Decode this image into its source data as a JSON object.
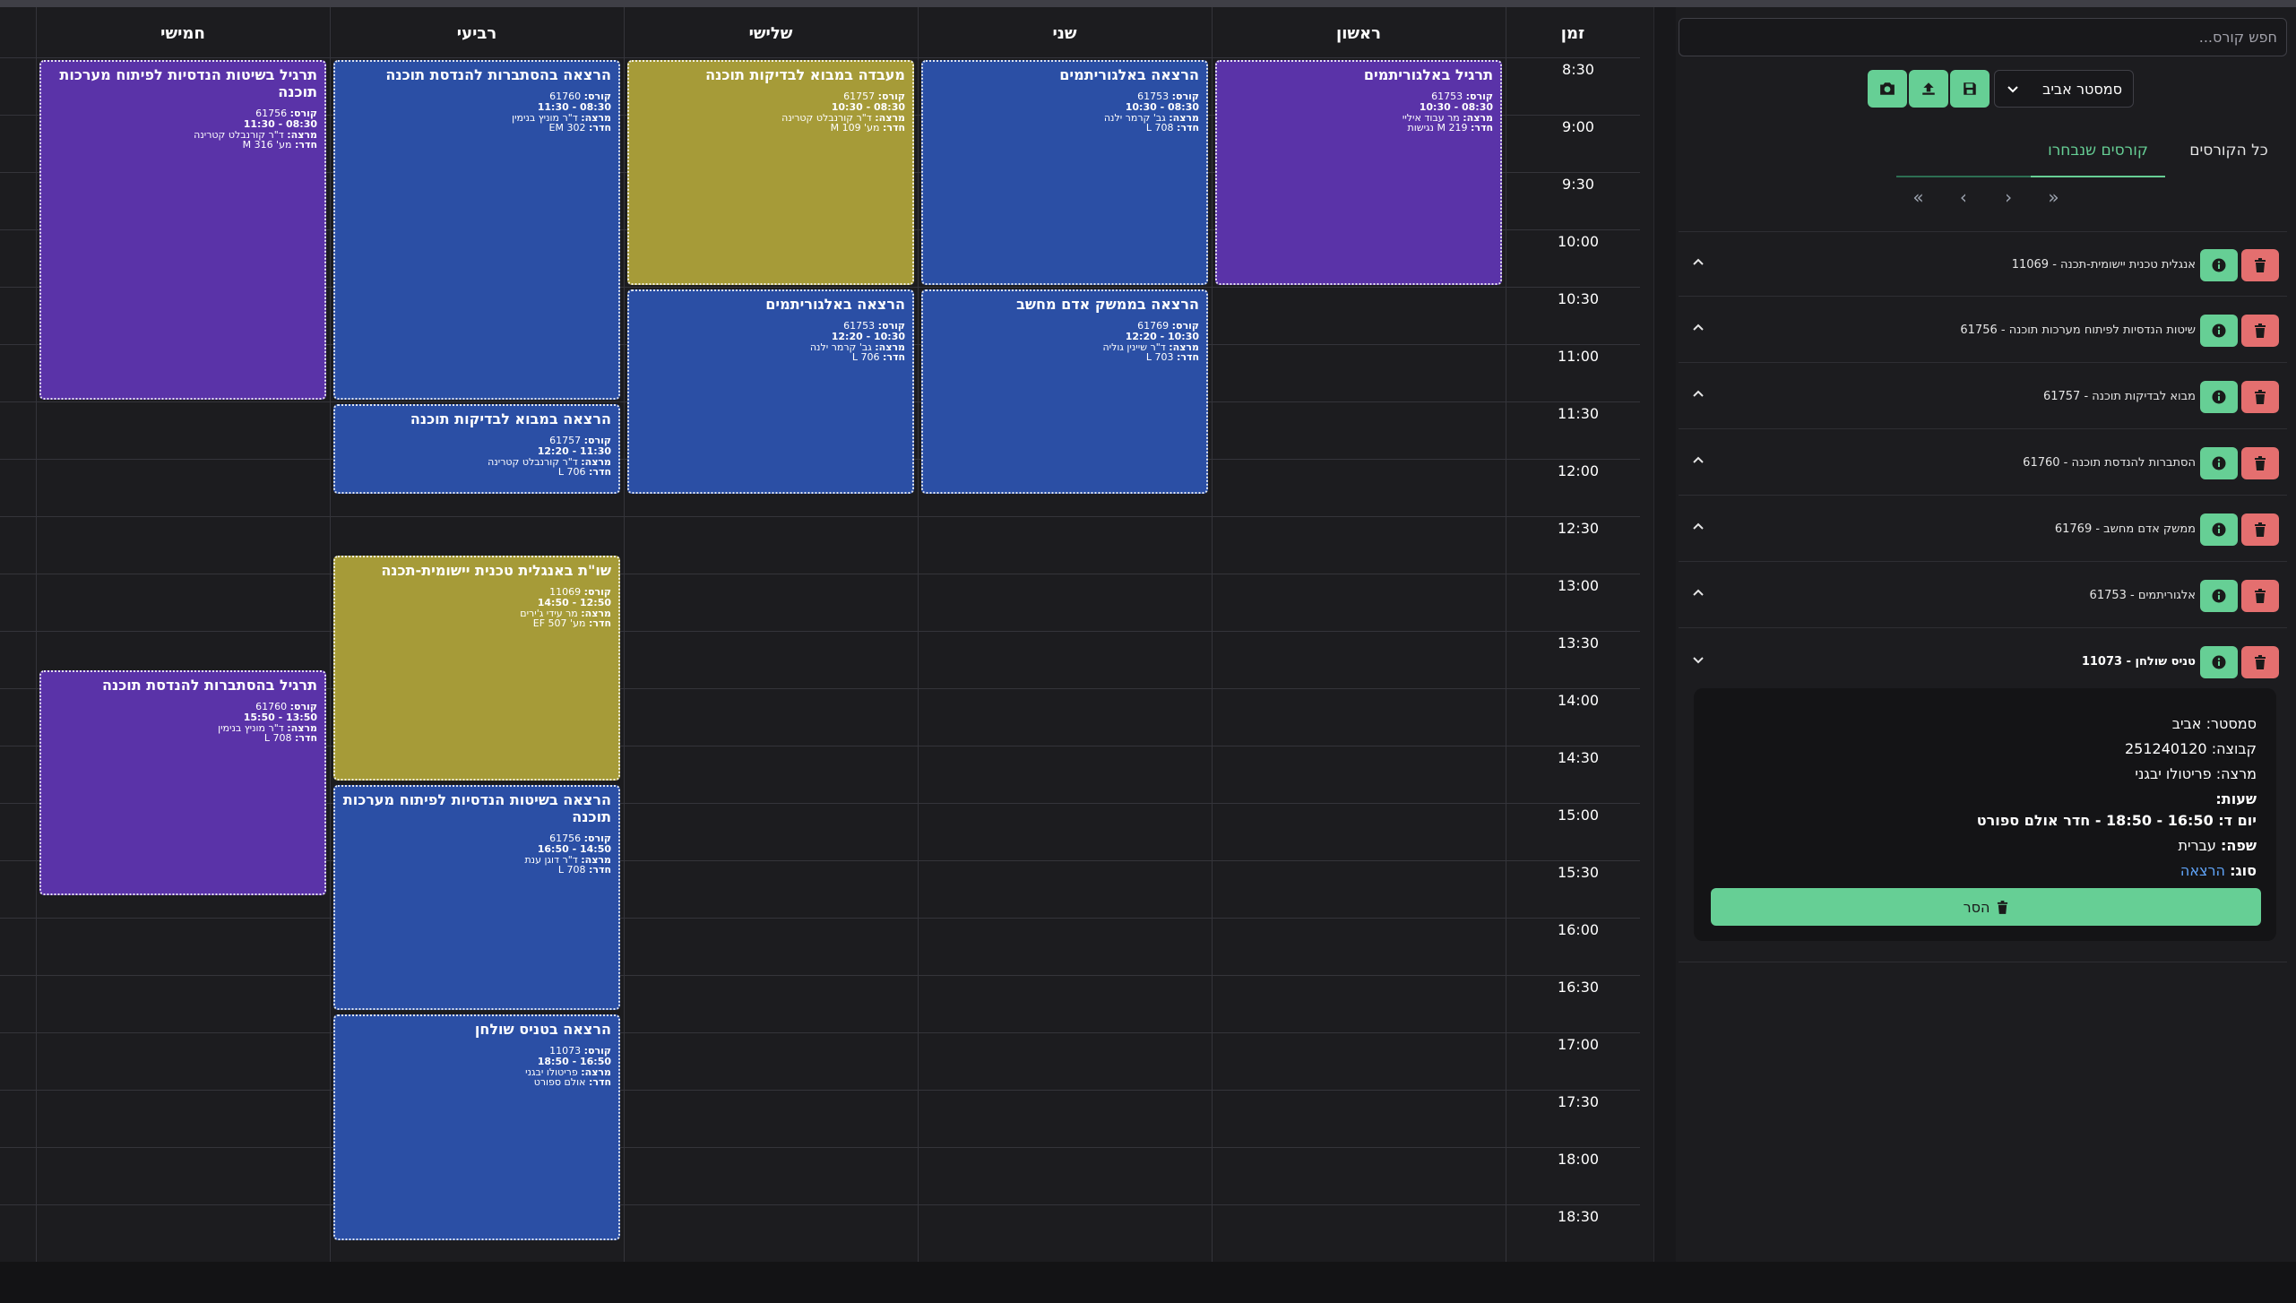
{
  "schedule": {
    "headers": {
      "time": "זמן",
      "sun": "ראשון",
      "mon": "שני",
      "tue": "שלישי",
      "wed": "רביעי",
      "thu": "חמישי"
    },
    "times": [
      "8:30",
      "9:00",
      "9:30",
      "10:00",
      "10:30",
      "11:00",
      "11:30",
      "12:00",
      "12:30",
      "13:00",
      "13:30",
      "14:00",
      "14:30",
      "15:00",
      "15:30",
      "16:00",
      "16:30",
      "17:00",
      "17:30",
      "18:00",
      "18:30"
    ],
    "labels": {
      "course": "קורס:",
      "lecturer": "מרצה:",
      "room": "חדר:"
    },
    "events": {
      "sun1": {
        "title": "תרגיל באלגוריתמים",
        "course": "61753",
        "time": "08:30 - 10:30",
        "lecturer": "מר עבוד איליי",
        "room": "M 219 נגישות",
        "color": "#5a33a8"
      },
      "mon1": {
        "title": "הרצאה באלגוריתמים",
        "course": "61753",
        "time": "08:30 - 10:30",
        "lecturer": "גב' קרמר ילנה",
        "room": "L 708",
        "color": "#2b4fa5"
      },
      "mon2": {
        "title": "הרצאה בממשק אדם מחשב",
        "course": "61769",
        "time": "10:30 - 12:20",
        "lecturer": "ד\"ר שיינין גוליה",
        "room": "L 703",
        "color": "#2b4fa5"
      },
      "tue1": {
        "title": "מעבדה במבוא לבדיקות תוכנה",
        "course": "61757",
        "time": "08:30 - 10:30",
        "lecturer": "ד\"ר קורנבלט קטרינה",
        "room": "מע' M 109",
        "color": "#a69b38"
      },
      "tue2": {
        "title": "הרצאה באלגוריתמים",
        "course": "61753",
        "time": "10:30 - 12:20",
        "lecturer": "גב' קרמר ילנה",
        "room": "L 706",
        "color": "#2b4fa5"
      },
      "wed1": {
        "title": "הרצאה בהסתברות להנדסת תוכנה",
        "course": "61760",
        "time": "08:30 - 11:30",
        "lecturer": "ד\"ר מוניץ בנימין",
        "room": "EM 302",
        "color": "#2b4fa5"
      },
      "wed2": {
        "title": "הרצאה במבוא לבדיקות תוכנה",
        "course": "61757",
        "time": "11:30 - 12:20",
        "lecturer": "ד\"ר קורנבלט קטרינה",
        "room": "L 706",
        "color": "#2b4fa5"
      },
      "wed3": {
        "title": "שו\"ת באנגלית טכנית יישומית-תכנה",
        "course": "11069",
        "time": "12:50 - 14:50",
        "lecturer": "מר עידי ג'ירים",
        "room": "מע' EF 507",
        "color": "#a69b38"
      },
      "wed4": {
        "title": "הרצאה בשיטות הנדסיות לפיתוח מערכות תוכנה",
        "course": "61756",
        "time": "14:50 - 16:50",
        "lecturer": "ד\"ר דוגן ענת",
        "room": "L 708",
        "color": "#2b4fa5"
      },
      "wed5": {
        "title": "הרצאה בטניס שולחן",
        "course": "11073",
        "time": "16:50 - 18:50",
        "lecturer": "פריטולו יבגני",
        "room": "אולם ספורט",
        "color": "#2b4fa5"
      },
      "thu1": {
        "title": "תרגיל בשיטות הנדסיות לפיתוח מערכות תוכנה",
        "course": "61756",
        "time": "08:30 - 11:30",
        "lecturer": "ד\"ר קורנבלט קטרינה",
        "room": "מע' M 316",
        "color": "#5a33a8"
      },
      "thu2": {
        "title": "תרגיל בהסתברות להנדסת תוכנה",
        "course": "61760",
        "time": "13:50 - 15:50",
        "lecturer": "ד\"ר מוניץ בנימין",
        "room": "L 708",
        "color": "#5a33a8"
      }
    }
  },
  "sidebar": {
    "search_placeholder": "חפש קורס...",
    "semester_value": "סמסטר אביב",
    "tabs": {
      "all": "כל הקורסים",
      "selected": "קורסים שנבחרו"
    },
    "pager": {
      "first": "«",
      "prev": "‹",
      "next": "›",
      "last": "»"
    },
    "courses": [
      {
        "name": "אנגלית טכנית יישומית-תכנה - 11069"
      },
      {
        "name": "שיטות הנדסיות לפיתוח מערכות תוכנה - 61756"
      },
      {
        "name": "מבוא לבדיקות תוכנה - 61757"
      },
      {
        "name": "הסתברות להנדסת תוכנה - 61760"
      },
      {
        "name": "ממשק אדם מחשב - 61769"
      },
      {
        "name": "אלגוריתמים - 61753"
      },
      {
        "name": "טניס שולחן - 11073"
      }
    ],
    "details": {
      "semester": "סמסטר: אביב",
      "group": "קבוצה: 251240120",
      "lecturer": "מרצה: פריטולו יבגני",
      "hours_label": "שעות:",
      "hours_value": "יום ד: 16:50 - 18:50 - חדר אולם ספורט",
      "language_label": "שפה:",
      "language_value": "עברית",
      "type_label": "סוג:",
      "type_value": "הרצאה",
      "remove_label": "הסר"
    },
    "accent_color": "#66cf95",
    "danger_color": "#e46f6f"
  }
}
